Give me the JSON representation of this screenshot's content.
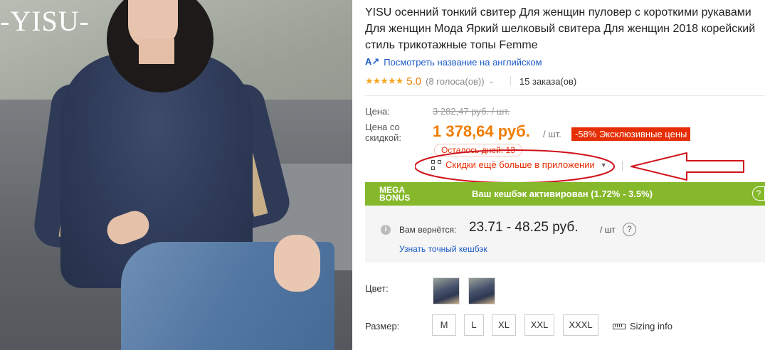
{
  "photo": {
    "brand_logo": "-YISU-"
  },
  "product": {
    "title_lines": [
      "YISU осенний тонкий свитер Для женщин пуловер с короткими рукавами",
      "Для женщин Мода Яркий шелковый свитера Для женщин 2018 корейский",
      "стиль трикотажные топы Femme"
    ],
    "translate_link": "Посмотреть название на английском",
    "rating": "5.0",
    "votes": "(8 голоса(ов))",
    "orders": "15 заказа(ов)"
  },
  "price": {
    "price_label": "Цена:",
    "old_price": "3 282,47 руб. / шт.",
    "discount_label": "Цена со скидкой:",
    "new_price": "1 378,64 руб.",
    "unit": "/ шт.",
    "discount_badge": "-58% Эксклюзивные цены",
    "days_left": "Осталось дней: 13",
    "app_discount": "Скидки ещё больше в приложении"
  },
  "bonus": {
    "mega_line1": "MEGA",
    "mega_line2": "BONUS",
    "message": "Ваш кешбэк активирован (1.72% - 3.5%)",
    "help": "?"
  },
  "cashback": {
    "label": "Вам вернётся:",
    "range": "23.71 - 48.25 руб.",
    "unit": "/ шт",
    "link": "Узнать точный кешбэк"
  },
  "options": {
    "color_label": "Цвет:",
    "size_label": "Размер:",
    "sizes": [
      "M",
      "L",
      "XL",
      "XXL",
      "XXXL"
    ],
    "sizing_info": "Sizing info"
  },
  "colors": {
    "annotation": "#d0121b",
    "price": "#f07c00",
    "badge": "#e62e04",
    "bonus": "#86b82b",
    "link": "#1a5ac8"
  }
}
